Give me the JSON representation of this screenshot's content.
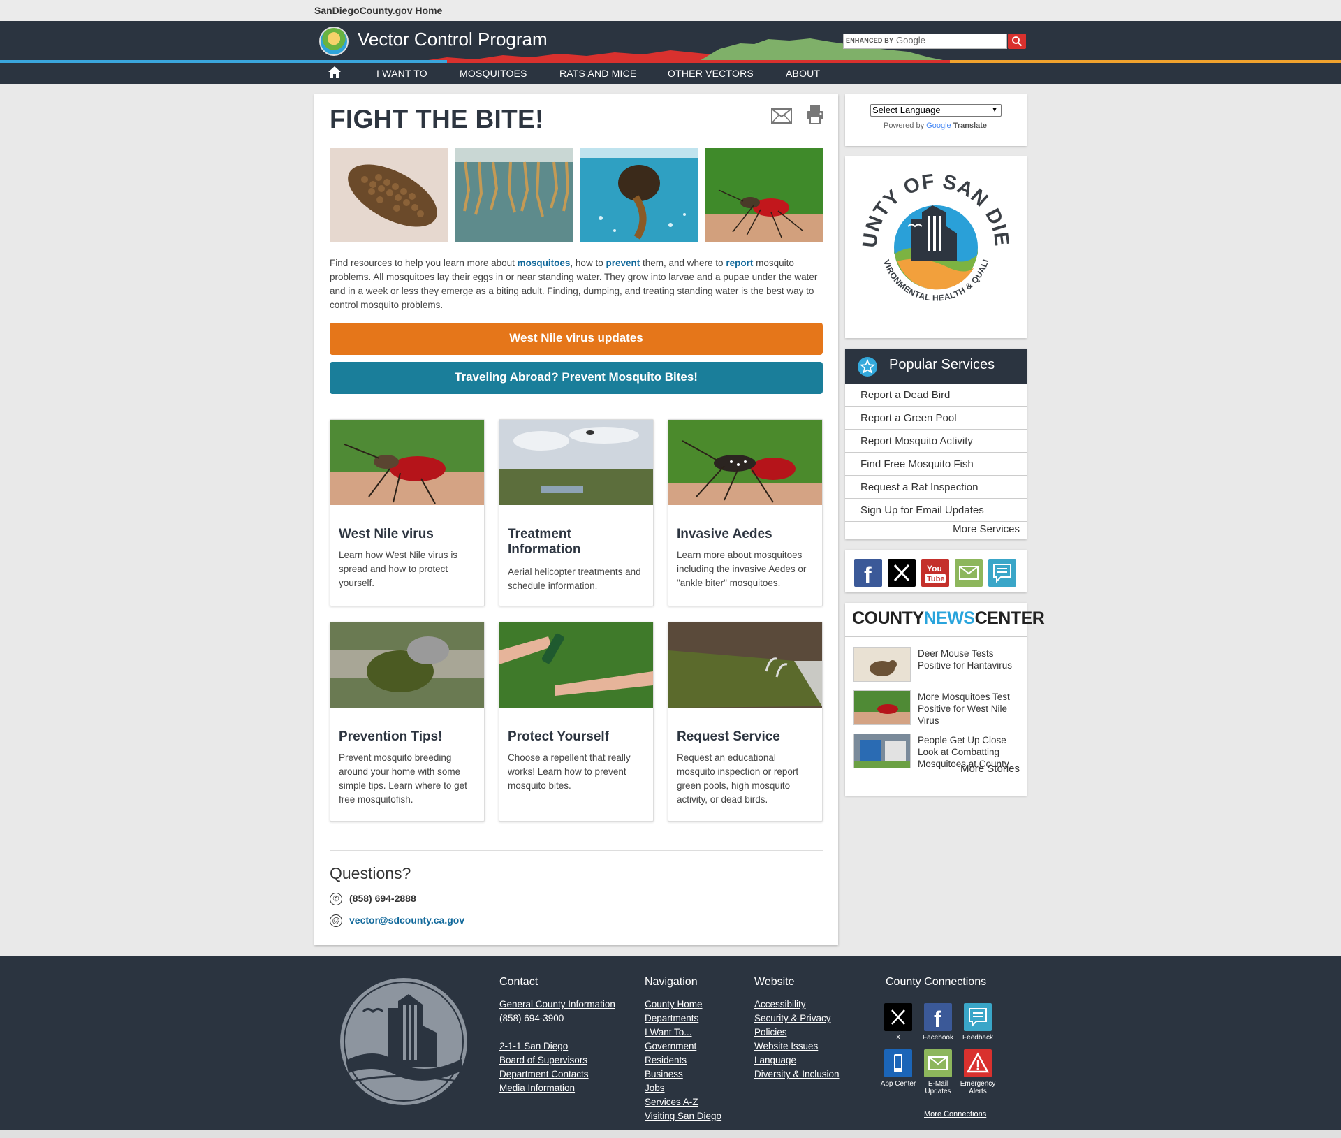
{
  "top_bar": {
    "site_link": "SanDiegoCounty.gov",
    "home": "Home"
  },
  "header": {
    "title": "Vector Control Program",
    "search": {
      "label": "ENHANCED BY",
      "brand": "Google"
    }
  },
  "nav": {
    "items": [
      "I WANT TO",
      "MOSQUITOES",
      "RATS AND MICE",
      "OTHER VECTORS",
      "ABOUT"
    ]
  },
  "main": {
    "title": "FIGHT THE BITE!",
    "intro": {
      "p1": "Find resources to help you learn more about ",
      "l1": "mosquitoes",
      "p2": ", how to ",
      "l2": "prevent",
      "p3": " them, and where to ",
      "l3": "report",
      "p4": " mosquito problems. All mosquitoes lay their eggs in or near standing water. They grow into larvae and a pupae under the water and in a week or less they emerge as a biting adult. Finding, dumping, and treating standing water is the best way to control mosquito problems."
    },
    "buttons": {
      "wnv": "West Nile virus updates",
      "travel": "Traveling Abroad? Prevent Mosquito Bites!"
    },
    "cards": [
      {
        "title": "West Nile virus",
        "text": "Learn how West Nile virus is spread and how to protect yourself."
      },
      {
        "title": "Treatment Information",
        "text": "Aerial helicopter treatments and schedule information."
      },
      {
        "title": "Invasive Aedes",
        "text": "Learn more about mosquitoes including the invasive Aedes or \"ankle biter\" mosquitoes."
      },
      {
        "title": "Prevention Tips!",
        "text": "Prevent mosquito breeding around your home with some simple tips. Learn where to get free mosquitofish."
      },
      {
        "title": "Protect Yourself",
        "text": "Choose a repellent that really works! Learn how to prevent mosquito bites."
      },
      {
        "title": "Request Service",
        "text": "Request an educational mosquito inspection or report green pools, high mosquito activity, or dead birds."
      }
    ],
    "questions": {
      "heading": "Questions?",
      "phone": "(858) 694-2888",
      "email": "vector@sdcounty.ca.gov"
    }
  },
  "sidebar": {
    "translate": {
      "select": "Select Language",
      "powered": "Powered by",
      "google": "Google",
      "translate": "Translate"
    },
    "logo": {
      "top_text": "COUNTY OF SAN DIEGO",
      "bottom_text": "ENVIRONMENTAL HEALTH & QUALITY"
    },
    "popular": {
      "title": "Popular Services",
      "items": [
        "Report a Dead Bird",
        "Report a Green Pool",
        "Report Mosquito Activity",
        "Find Free Mosquito Fish",
        "Request a Rat Inspection",
        "Sign Up for Email Updates"
      ],
      "more": "More Services"
    },
    "social": [
      "facebook-icon",
      "x-icon",
      "youtube-icon",
      "email-icon",
      "feedback-icon"
    ],
    "news": {
      "title_a": "COUNTY",
      "title_b": "NEWS",
      "title_c": "CENTER",
      "items": [
        "Deer Mouse Tests Positive for Hantavirus",
        "More Mosquitoes Test Positive for West Nile Virus",
        "People Get Up Close Look at Combatting Mosquitoes at County"
      ],
      "more": "More Stories"
    }
  },
  "footer": {
    "contact": {
      "heading": "Contact",
      "general": "General County Information",
      "phone": "(858) 694-3900",
      "links": [
        "2-1-1 San Diego",
        "Board of Supervisors",
        "Department Contacts",
        "Media Information"
      ]
    },
    "navigation": {
      "heading": "Navigation",
      "links": [
        "County Home",
        "Departments",
        "I Want To...",
        "Government",
        "Residents",
        "Business",
        "Jobs",
        "Services A-Z",
        "Visiting San Diego"
      ]
    },
    "website": {
      "heading": "Website",
      "links": [
        "Accessibility",
        "Security & Privacy",
        "Policies",
        "Website Issues",
        "Language",
        "Diversity & Inclusion"
      ]
    },
    "connections": {
      "heading": "County Connections",
      "items": [
        "X",
        "Facebook",
        "Feedback",
        "App Center",
        "E-Mail Updates",
        "Emergency Alerts"
      ],
      "more": "More Connections"
    }
  },
  "colors": {
    "dark": "#2b3440",
    "orange_button": "#e5761a",
    "teal_button": "#1a7e9a",
    "link_blue": "#12699b",
    "accent_blue": "#29a4dc"
  }
}
